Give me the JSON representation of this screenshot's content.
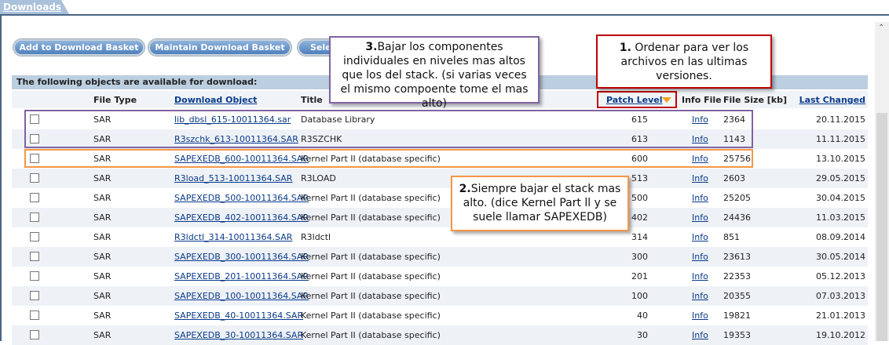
{
  "tab": {
    "label": "Downloads"
  },
  "buttons": [
    "Add to Download Basket",
    "Maintain Download Basket",
    "Sele"
  ],
  "band": "The following objects are available for download:",
  "headers": {
    "file_type": "File Type",
    "download_object": "Download Object",
    "title": "Title",
    "patch_level": "Patch Level",
    "info_file": "Info File",
    "file_size": "File Size [kb]",
    "last_changed": "Last Changed"
  },
  "rows": [
    {
      "type": "SAR",
      "object": "lib_dbsl_615-10011364.sar",
      "title": "Database Library",
      "patch": "615",
      "info": "Info",
      "size": "2364",
      "date": "20.11.2015"
    },
    {
      "type": "SAR",
      "object": "R3szchk_613-10011364.SAR",
      "title": "R3SZCHK",
      "patch": "613",
      "info": "Info",
      "size": "1143",
      "date": "11.11.2015"
    },
    {
      "type": "SAR",
      "object": "SAPEXEDB_600-10011364.SAR",
      "title": "Kernel Part II (database specific)",
      "patch": "600",
      "info": "Info",
      "size": "25756",
      "date": "13.10.2015"
    },
    {
      "type": "SAR",
      "object": "R3load_513-10011364.SAR",
      "title": "R3LOAD",
      "patch": "513",
      "info": "Info",
      "size": "2603",
      "date": "29.05.2015"
    },
    {
      "type": "SAR",
      "object": "SAPEXEDB_500-10011364.SAR",
      "title": "Kernel Part II (database specific)",
      "patch": "500",
      "info": "Info",
      "size": "25205",
      "date": "30.04.2015"
    },
    {
      "type": "SAR",
      "object": "SAPEXEDB_402-10011364.SAR",
      "title": "Kernel Part II (database specific)",
      "patch": "402",
      "info": "Info",
      "size": "24436",
      "date": "11.03.2015"
    },
    {
      "type": "SAR",
      "object": "R3ldctl_314-10011364.SAR",
      "title": "R3ldctl",
      "patch": "314",
      "info": "Info",
      "size": "851",
      "date": "08.09.2014"
    },
    {
      "type": "SAR",
      "object": "SAPEXEDB_300-10011364.SAR",
      "title": "Kernel Part II (database specific)",
      "patch": "300",
      "info": "Info",
      "size": "23613",
      "date": "30.05.2014"
    },
    {
      "type": "SAR",
      "object": "SAPEXEDB_201-10011364.SAR",
      "title": "Kernel Part II (database specific)",
      "patch": "201",
      "info": "Info",
      "size": "22353",
      "date": "05.12.2013"
    },
    {
      "type": "SAR",
      "object": "SAPEXEDB_100-10011364.SAR",
      "title": "Kernel Part II (database specific)",
      "patch": "100",
      "info": "Info",
      "size": "20355",
      "date": "07.03.2013"
    },
    {
      "type": "SAR",
      "object": "SAPEXEDB_40-10011364.SAR",
      "title": "Kernel Part II (database specific)",
      "patch": "40",
      "info": "Info",
      "size": "19821",
      "date": "21.01.2013"
    },
    {
      "type": "SAR",
      "object": "SAPEXEDB_30-10011364.SAR",
      "title": "Kernel Part II (database specific)",
      "patch": "30",
      "info": "Info",
      "size": "19353",
      "date": "19.10.2012"
    }
  ],
  "callouts": {
    "c1": {
      "num": "1.",
      "text": " Ordenar para ver los archivos en las ultimas versiones."
    },
    "c2": {
      "num": "2.",
      "text": "Siempre bajar el stack mas alto. (dice Kernel Part ll y se suele llamar SAPEXEDB)"
    },
    "c3": {
      "num": "3.",
      "text": "Bajar los componentes individuales en niveles mas altos que los del stack. (si varias veces el mismo compoente tome el mas alto)"
    }
  },
  "colors": {
    "purple": "#8064a2",
    "orange": "#f79646",
    "red": "#c00000",
    "link": "#0a3a8a"
  }
}
